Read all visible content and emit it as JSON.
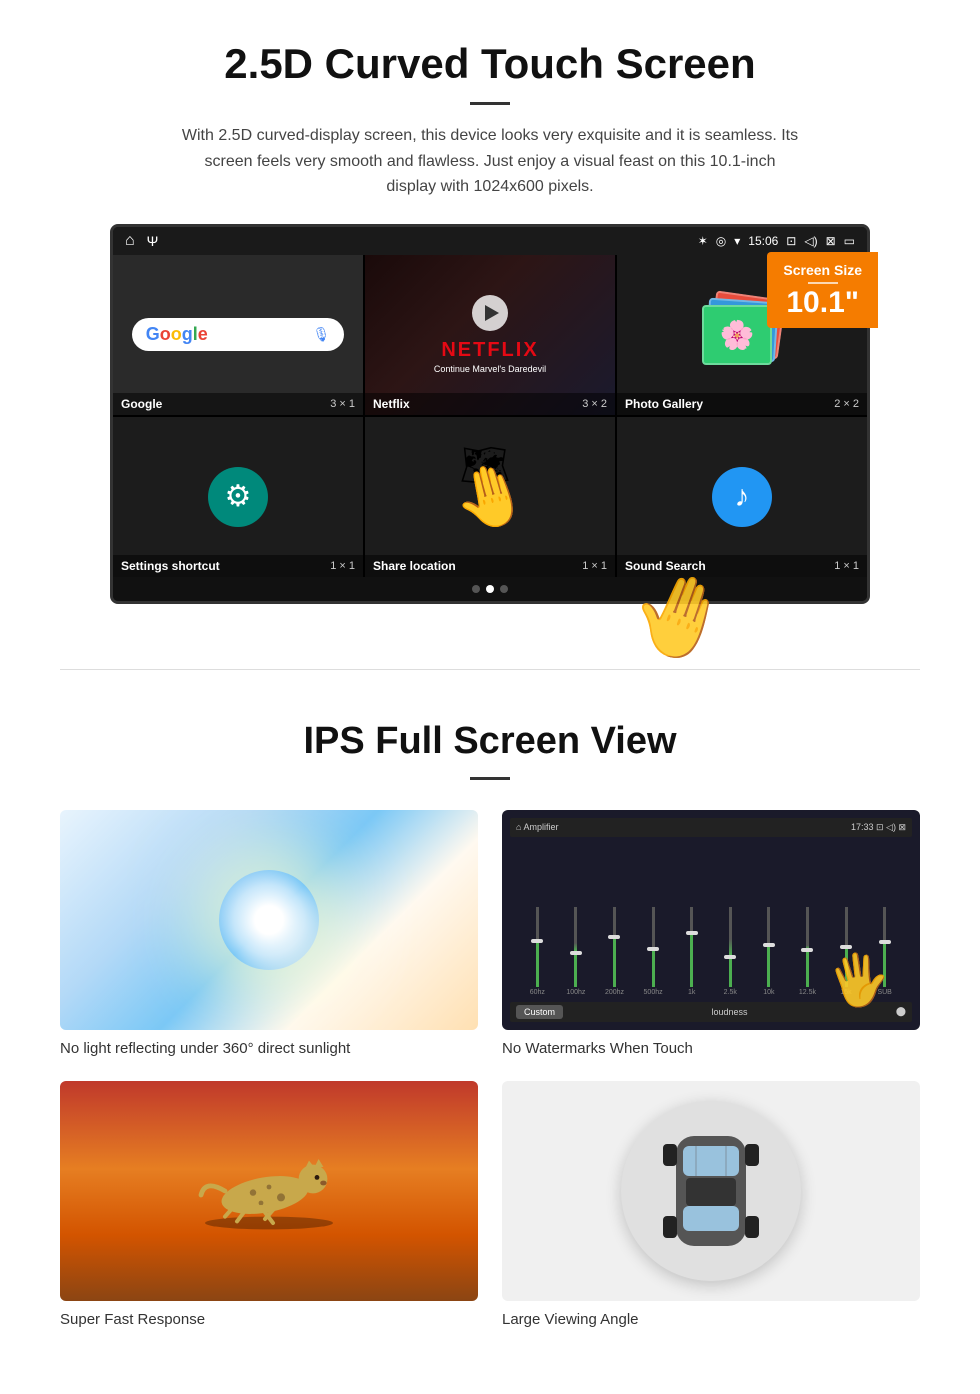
{
  "section1": {
    "title": "2.5D Curved Touch Screen",
    "description": "With 2.5D curved-display screen, this device looks very exquisite and it is seamless. Its screen feels very smooth and flawless. Just enjoy a visual feast on this 10.1-inch display with 1024x600 pixels.",
    "screen_size_label": "Screen Size",
    "screen_size_value": "10.1\"",
    "status_time": "15:06",
    "apps": [
      {
        "name": "Google",
        "size": "3 × 1"
      },
      {
        "name": "Netflix",
        "size": "3 × 2"
      },
      {
        "name": "Photo Gallery",
        "size": "2 × 2"
      },
      {
        "name": "Settings shortcut",
        "size": "1 × 1"
      },
      {
        "name": "Share location",
        "size": "1 × 1"
      },
      {
        "name": "Sound Search",
        "size": "1 × 1"
      }
    ],
    "netflix_text": "NETFLIX",
    "netflix_subtitle": "Continue Marvel's Daredevil"
  },
  "section2": {
    "title": "IPS Full Screen View",
    "features": [
      {
        "label": "No light reflecting under 360° direct sunlight"
      },
      {
        "label": "No Watermarks When Touch"
      },
      {
        "label": "Super Fast Response"
      },
      {
        "label": "Large Viewing Angle"
      }
    ]
  }
}
